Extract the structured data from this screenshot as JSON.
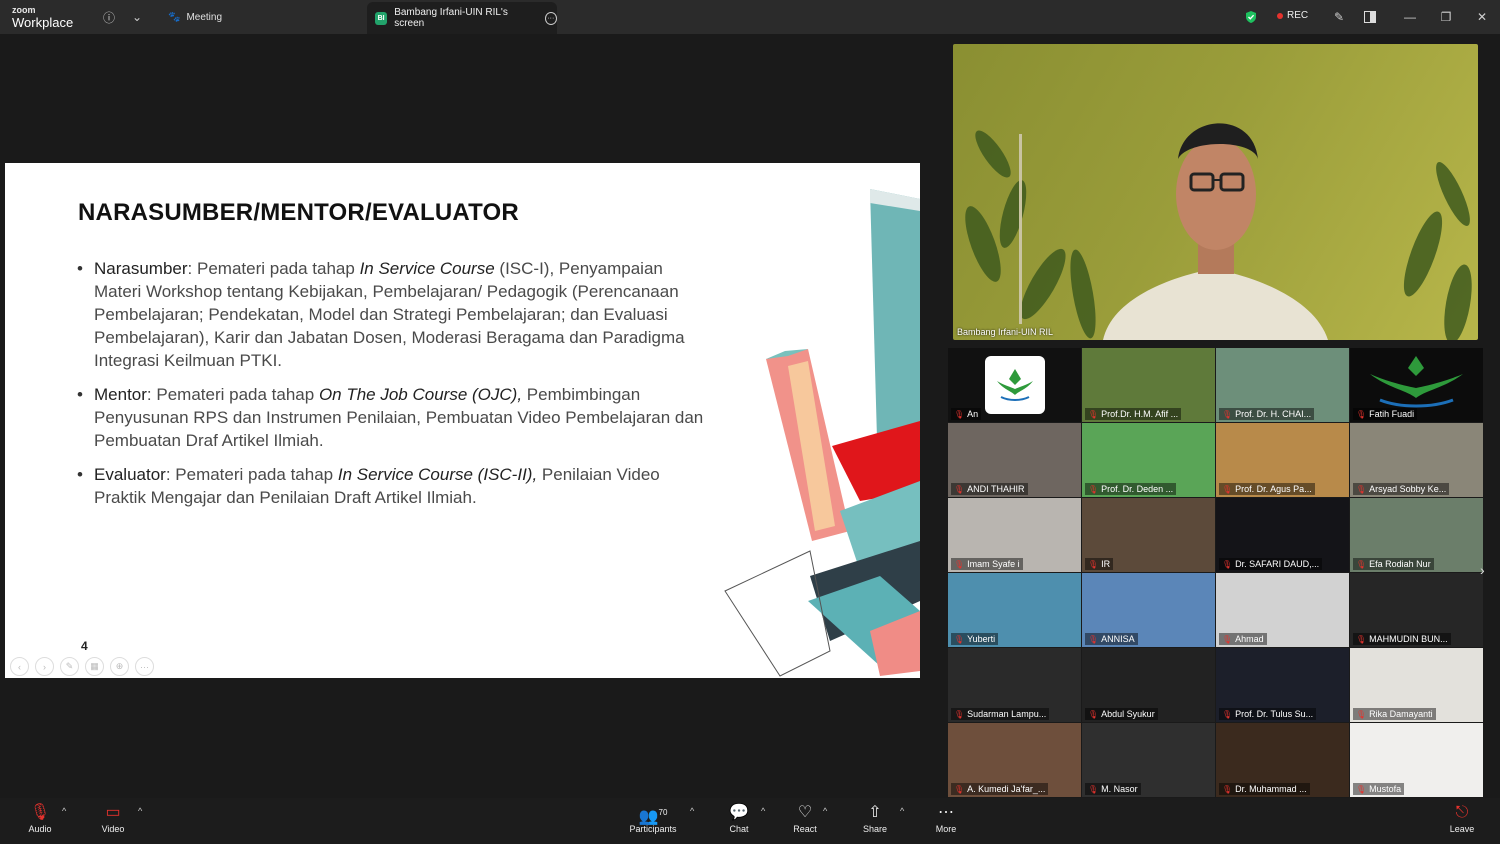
{
  "window": {
    "brand_line1": "zoom",
    "brand_line2": "Workplace",
    "meeting_label": "Meeting",
    "share_badge": "BI",
    "share_tab_label": "Bambang Irfani-UIN RIL's screen",
    "rec_label": "REC"
  },
  "slide": {
    "title": "NARASUMBER/MENTOR/EVALUATOR",
    "bullets": [
      {
        "head": "Narasumber",
        "text1": ": Pemateri pada tahap ",
        "em": "In Service Course",
        "text2": " (ISC-I), Penyampaian Materi Workshop tentang Kebijakan, Pembelajaran/ Pedagogik (Perencanaan Pembelajaran; Pendekatan, Model dan Strategi Pembelajaran; dan Evaluasi Pembelajaran), Karir dan Jabatan Dosen, Moderasi Beragama dan Paradigma Integrasi Keilmuan PTKI."
      },
      {
        "head": "Mentor",
        "text1": ": Pemateri pada tahap ",
        "em": "On The Job Course (OJC),",
        "text2": " Pembimbingan Penyusunan RPS dan Instrumen Penilaian, Pembuatan Video Pembelajaran dan Pembuatan Draf Artikel Ilmiah."
      },
      {
        "head": "Evaluator",
        "text1": ": Pemateri pada tahap ",
        "em": "In Service Course (ISC-II),",
        "text2": " Penilaian Video Praktik Mengajar dan Penilaian Draft Artikel Ilmiah."
      }
    ],
    "page_number": "4"
  },
  "speaker": {
    "name": "Bambang Irfani-UIN RIL"
  },
  "participants": [
    {
      "name": "An",
      "bg": "#111111",
      "logo": true
    },
    {
      "name": "Prof.Dr. H.M. Afif ...",
      "bg": "#5f7a3a"
    },
    {
      "name": "Prof. Dr. H. CHAI...",
      "bg": "#6d8f7a"
    },
    {
      "name": "Fatih Fuadi",
      "bg": "#0c0c0c",
      "logo2": true
    },
    {
      "name": "ANDI THAHIR",
      "bg": "#6e6660"
    },
    {
      "name": "Prof. Dr. Deden ...",
      "bg": "#5aa557"
    },
    {
      "name": "Prof. Dr. Agus Pa...",
      "bg": "#b88a4a"
    },
    {
      "name": "Arsyad Sobby Ke...",
      "bg": "#8a8678"
    },
    {
      "name": "Imam Syafe i",
      "bg": "#b9b5b0"
    },
    {
      "name": "IR",
      "bg": "#5c4a3a"
    },
    {
      "name": "Dr. SAFARI DAUD,...",
      "bg": "#141418"
    },
    {
      "name": "Efa Rodiah Nur",
      "bg": "#6b7e6a"
    },
    {
      "name": "Yuberti",
      "bg": "#4e8fae"
    },
    {
      "name": "ANNISA",
      "bg": "#5b86b8"
    },
    {
      "name": "Ahmad",
      "bg": "#d2d2d2"
    },
    {
      "name": "MAHMUDIN BUN...",
      "bg": "#262626"
    },
    {
      "name": "Sudarman Lampu...",
      "bg": "#2a2a2a"
    },
    {
      "name": "Abdul Syukur",
      "bg": "#222222"
    },
    {
      "name": "Prof. Dr. Tulus Su...",
      "bg": "#1c1f2a"
    },
    {
      "name": "Rika Damayanti",
      "bg": "#e3e1dc"
    },
    {
      "name": "A. Kumedi Ja'far_...",
      "bg": "#6e4f3c"
    },
    {
      "name": "M. Nasor",
      "bg": "#2f2f2f"
    },
    {
      "name": "Dr. Muhammad ...",
      "bg": "#3b2a1e"
    },
    {
      "name": "Mustofa",
      "bg": "#f0efed"
    }
  ],
  "toolbar": {
    "audio": "Audio",
    "video": "Video",
    "participants": "Participants",
    "participants_count": "70",
    "chat": "Chat",
    "react": "React",
    "share": "Share",
    "more": "More",
    "leave": "Leave"
  }
}
